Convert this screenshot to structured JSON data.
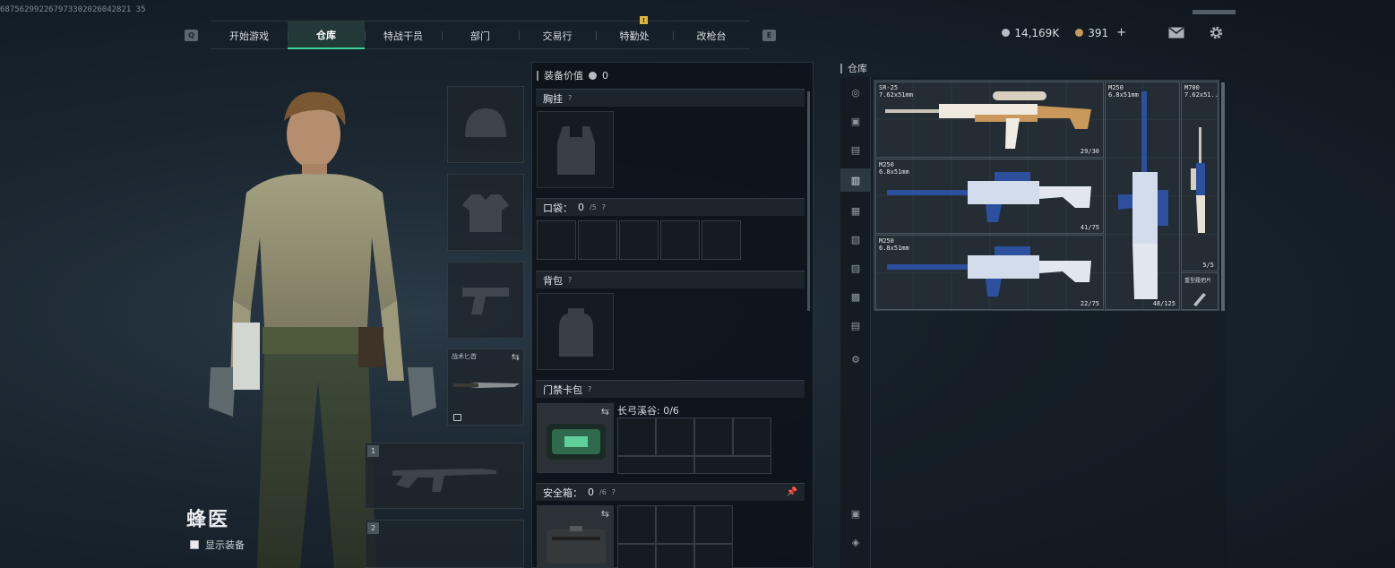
{
  "session_id": "687562992267973302026042821 35",
  "nav": {
    "left_key": "Q",
    "right_key": "E",
    "tabs": [
      "开始游戏",
      "仓库",
      "特战干员",
      "部门",
      "交易行",
      "特勤处",
      "改枪台"
    ],
    "active": "仓库",
    "badge": "!"
  },
  "currency": {
    "silver": "14,169K",
    "gold": "391",
    "plus": "+"
  },
  "character": {
    "name": "蜂医",
    "show_equipment": "显示装备"
  },
  "slots": {
    "melee_label": "战术匕首",
    "primary_num": "1",
    "secondary_num": "2"
  },
  "mid": {
    "equip_value_label": "装备价值",
    "equip_value": "0",
    "chest_rig": "胸挂",
    "pocket_label": "口袋：",
    "pocket_value": "0",
    "pocket_max": "/5",
    "backpack": "背包",
    "keycard": "门禁卡包",
    "keycard_map": "长弓溪谷: 0/6",
    "safebox_label": "安全箱：",
    "safebox_value": "0",
    "safebox_max": "/6",
    "q": "?"
  },
  "warehouse": {
    "title": "仓库",
    "items": [
      {
        "name": "SR-25",
        "caliber": "7.62x51mm",
        "ammo": "29/30"
      },
      {
        "name": "M250",
        "caliber": "6.8x51mm",
        "ammo": "41/75"
      },
      {
        "name": "M250",
        "caliber": "6.8x51mm",
        "ammo": "22/75"
      },
      {
        "name": "M250",
        "caliber": "6.8x51mm",
        "ammo": "48/125"
      },
      {
        "name": "M700",
        "caliber": "7.62x51...",
        "ammo": "5/5"
      },
      {
        "name": "重型履把片",
        "caliber": "",
        "ammo": ""
      }
    ]
  },
  "colors": {
    "accent": "#3fd49a",
    "badge": "#e0b53a",
    "gold_weapon": "#c9985a",
    "blue_weapon": "#2c4f9e"
  }
}
